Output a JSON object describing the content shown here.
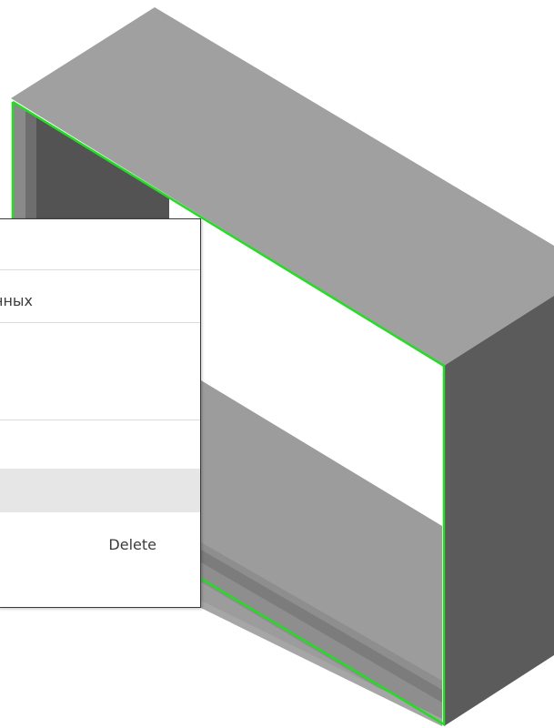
{
  "context_menu": {
    "items": [
      {
        "label": ""
      },
      {
        "label": "нных"
      },
      {
        "label": ""
      },
      {
        "label": ""
      },
      {
        "label": ""
      },
      {
        "label": "Delete"
      },
      {
        "label": ""
      }
    ],
    "highlight_color": "#e6e6e6"
  },
  "model": {
    "selection_color": "#22dd22",
    "face_colors": {
      "top": "#a0a0a0",
      "side": "#5a5a5a",
      "inner": "#4f4f4f",
      "shelf": "#9a9a9a"
    }
  }
}
